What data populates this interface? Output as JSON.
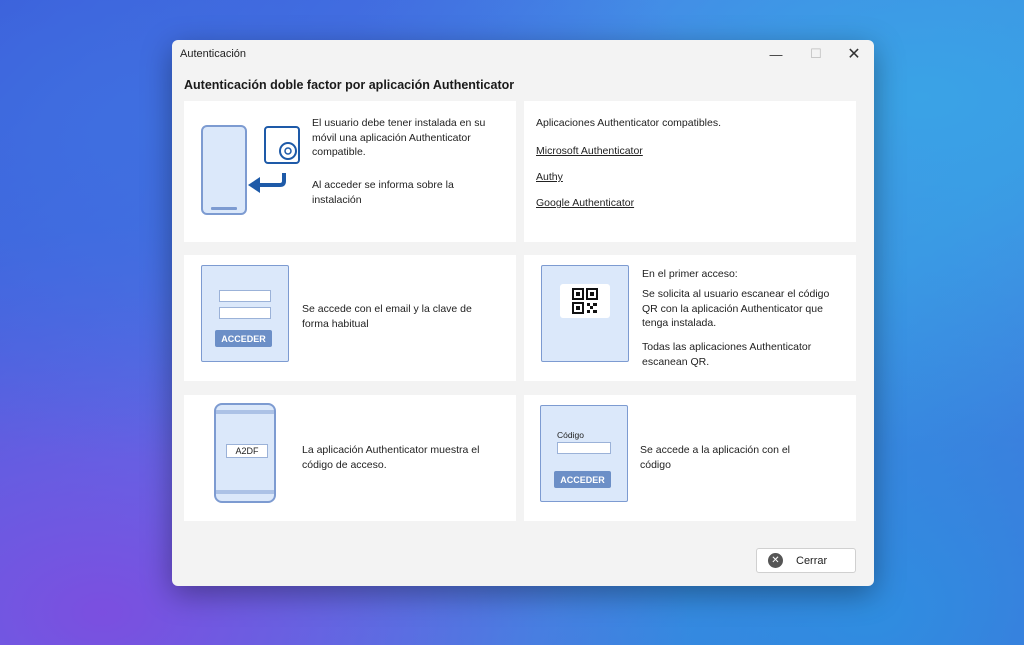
{
  "window": {
    "title": "Autenticación",
    "minimize_glyph": "—",
    "maximize_glyph": "☐",
    "close_glyph": "✕"
  },
  "heading": "Autenticación doble factor por aplicación Authenticator",
  "card1": {
    "icon": "phone-sync-gear-icon",
    "text1": "El usuario debe tener instalada en su móvil una aplicación Authenticator compatible.",
    "text2": "Al acceder se informa sobre la instalación"
  },
  "card2": {
    "intro": "Aplicaciones Authenticator compatibles.",
    "apps": [
      "Microsoft Authenticator",
      "Authy",
      "Google Authenticator"
    ]
  },
  "card3": {
    "button_label": "ACCEDER",
    "text": "Se accede con el email y la clave de forma habitual"
  },
  "card4": {
    "icon": "qr-code-icon",
    "line1": "En el primer acceso:",
    "line2": "Se solicita al usuario escanear el código QR con la aplicación Authenticator que tenga instalada.",
    "line3": "Todas las aplicaciones Authenticator escanean QR."
  },
  "card5": {
    "code": "A2DF",
    "text": "La aplicación Authenticator muestra el código de acceso."
  },
  "card6": {
    "field_label": "Código",
    "button_label": "ACCEDER",
    "text": "Se accede a la aplicación con el código"
  },
  "footer": {
    "close_label": "Cerrar",
    "close_icon": "circle-x-icon"
  },
  "colors": {
    "accent": "#6c8fc7",
    "illustration_fill": "#dbe8fa",
    "arrow": "#1e5aa8"
  }
}
